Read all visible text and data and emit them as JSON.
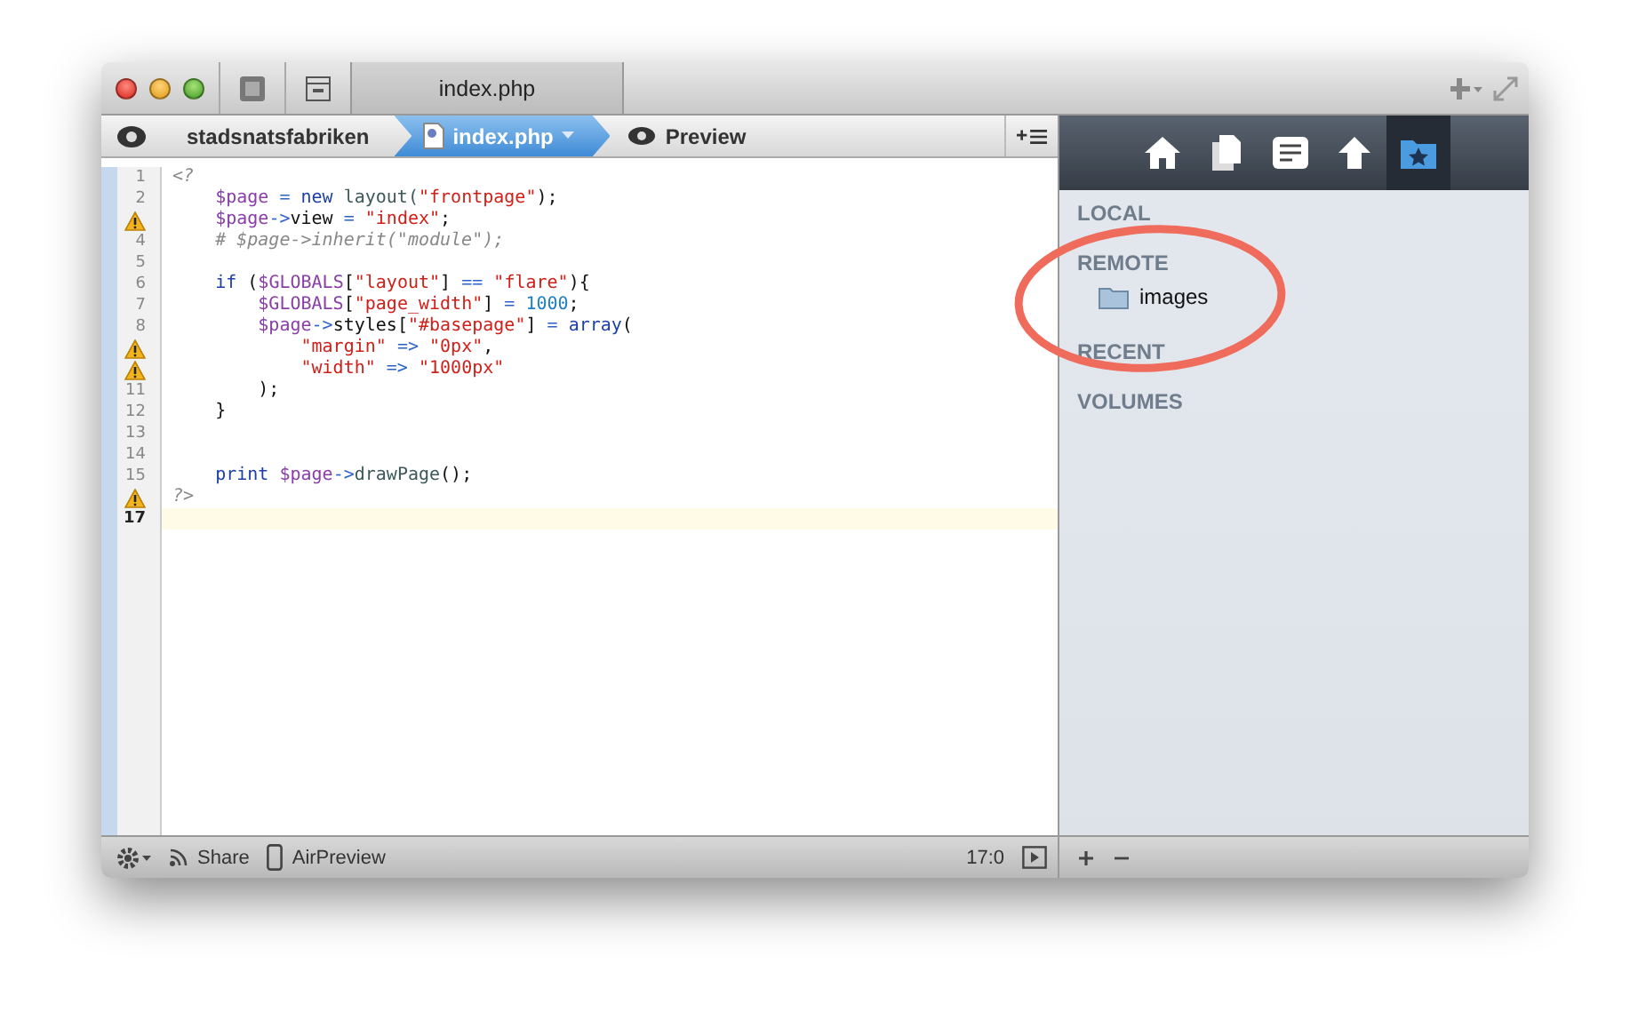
{
  "window": {
    "title_tab": "index.php"
  },
  "breadcrumb": [
    {
      "label": "stadsnatsfabriken",
      "kind": "folder",
      "selected": false
    },
    {
      "label": "index.php",
      "kind": "file",
      "selected": true
    },
    {
      "label": "Preview",
      "kind": "preview",
      "selected": false
    }
  ],
  "editor": {
    "lines": [
      {
        "number": "1",
        "warning": false,
        "current": false,
        "tokens": [
          {
            "kind": "tag",
            "text": "<?"
          }
        ]
      },
      {
        "number": "2",
        "warning": false,
        "current": false,
        "tokens": [
          {
            "kind": "var",
            "text": "    $page"
          },
          {
            "kind": "op",
            "text": " = "
          },
          {
            "kind": "keyword",
            "text": "new"
          },
          {
            "kind": "func",
            "text": " layout("
          },
          {
            "kind": "string",
            "text": "\"frontpage\""
          },
          {
            "kind": "plain",
            "text": ");"
          }
        ]
      },
      {
        "warning": true,
        "current": false,
        "tokens": [
          {
            "kind": "var",
            "text": "    $page"
          },
          {
            "kind": "op",
            "text": "->"
          },
          {
            "kind": "plain",
            "text": "view"
          },
          {
            "kind": "op",
            "text": " = "
          },
          {
            "kind": "string",
            "text": "\"index\""
          },
          {
            "kind": "plain",
            "text": ";"
          }
        ]
      },
      {
        "number": "4",
        "warning": false,
        "current": false,
        "tokens": [
          {
            "kind": "comment",
            "text": "    # $page->inherit(\"module\");"
          }
        ]
      },
      {
        "number": "5",
        "warning": false,
        "current": false
      },
      {
        "number": "6",
        "warning": false,
        "current": false,
        "tokens": [
          {
            "kind": "keyword",
            "text": "    if"
          },
          {
            "kind": "plain",
            "text": " ("
          },
          {
            "kind": "var",
            "text": "$GLOBALS"
          },
          {
            "kind": "plain",
            "text": "["
          },
          {
            "kind": "string",
            "text": "\"layout\""
          },
          {
            "kind": "plain",
            "text": "]"
          },
          {
            "kind": "op",
            "text": " == "
          },
          {
            "kind": "string",
            "text": "\"flare\""
          },
          {
            "kind": "plain",
            "text": "){"
          }
        ]
      },
      {
        "number": "7",
        "warning": false,
        "current": false,
        "tokens": [
          {
            "kind": "var",
            "text": "        $GLOBALS"
          },
          {
            "kind": "plain",
            "text": "["
          },
          {
            "kind": "string",
            "text": "\"page_width\""
          },
          {
            "kind": "plain",
            "text": "]"
          },
          {
            "kind": "op",
            "text": " = "
          },
          {
            "kind": "number",
            "text": "1000"
          },
          {
            "kind": "plain",
            "text": ";"
          }
        ]
      },
      {
        "number": "8",
        "warning": false,
        "current": false,
        "tokens": [
          {
            "kind": "var",
            "text": "        $page"
          },
          {
            "kind": "op",
            "text": "->"
          },
          {
            "kind": "plain",
            "text": "styles["
          },
          {
            "kind": "string",
            "text": "\"#basepage\""
          },
          {
            "kind": "plain",
            "text": "]"
          },
          {
            "kind": "op",
            "text": " = "
          },
          {
            "kind": "keyword",
            "text": "array"
          },
          {
            "kind": "plain",
            "text": "("
          }
        ]
      },
      {
        "warning": true,
        "current": false,
        "tokens": [
          {
            "kind": "string",
            "text": "            \"margin\""
          },
          {
            "kind": "op",
            "text": " => "
          },
          {
            "kind": "string",
            "text": "\"0px\""
          },
          {
            "kind": "plain",
            "text": ","
          }
        ]
      },
      {
        "warning": true,
        "current": false,
        "tokens": [
          {
            "kind": "string",
            "text": "            \"width\""
          },
          {
            "kind": "op",
            "text": " => "
          },
          {
            "kind": "string",
            "text": "\"1000px\""
          }
        ]
      },
      {
        "number": "11",
        "warning": false,
        "current": false,
        "tokens": [
          {
            "kind": "plain",
            "text": "        );"
          }
        ]
      },
      {
        "number": "12",
        "warning": false,
        "current": false,
        "tokens": [
          {
            "kind": "plain",
            "text": "    }"
          }
        ]
      },
      {
        "number": "13",
        "warning": false,
        "current": false
      },
      {
        "number": "14",
        "warning": false,
        "current": false
      },
      {
        "number": "15",
        "warning": false,
        "current": false,
        "tokens": [
          {
            "kind": "keyword",
            "text": "    print"
          },
          {
            "kind": "var",
            "text": " $page"
          },
          {
            "kind": "op",
            "text": "->"
          },
          {
            "kind": "func",
            "text": "drawPage"
          },
          {
            "kind": "plain",
            "text": "();"
          }
        ]
      },
      {
        "warning": true,
        "current": false,
        "tokens": [
          {
            "kind": "tag",
            "text": "?>"
          }
        ]
      },
      {
        "number": "17",
        "warning": false,
        "current": true
      }
    ]
  },
  "sidebar": {
    "toolbar": [
      {
        "kind": "home",
        "selected": false
      },
      {
        "kind": "files",
        "selected": false
      },
      {
        "kind": "note",
        "selected": false
      },
      {
        "kind": "upload",
        "selected": false
      },
      {
        "kind": "favorites",
        "selected": true
      }
    ],
    "sections": [
      {
        "label": "LOCAL"
      },
      {
        "label": "REMOTE",
        "children": [
          {
            "label": "images"
          }
        ]
      },
      {
        "label": "RECENT"
      },
      {
        "label": "VOLUMES"
      }
    ]
  },
  "status_bar": {
    "share": "Share",
    "airpreview": "AirPreview",
    "position": "17:0"
  }
}
